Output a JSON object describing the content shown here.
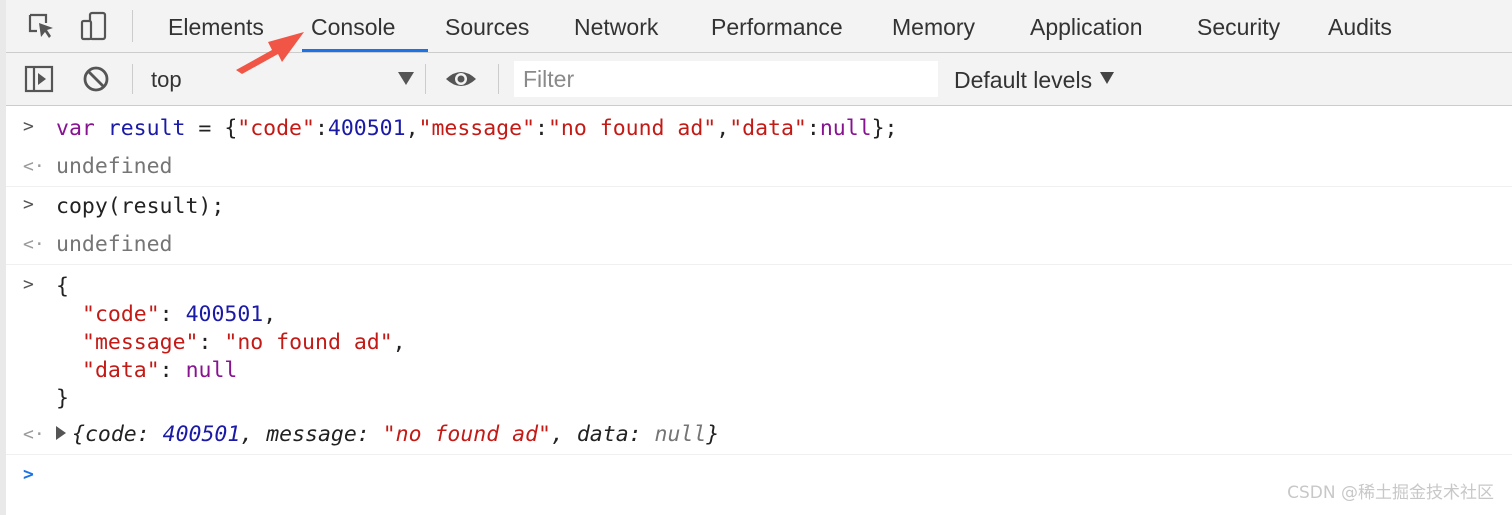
{
  "tabs": [
    "Elements",
    "Console",
    "Sources",
    "Network",
    "Performance",
    "Memory",
    "Application",
    "Security",
    "Audits"
  ],
  "active_tab": "Console",
  "toolbar": {
    "context": "top",
    "filter_placeholder": "Filter",
    "levels": "Default levels"
  },
  "console": {
    "line1": {
      "kw": "var",
      "ident": "result",
      "eq": " = ",
      "open": "{",
      "k1": "\"code\"",
      "v1": "400501",
      "k2": "\"message\"",
      "v2": "\"no found ad\"",
      "k3": "\"data\"",
      "v3": "null",
      "close": "};"
    },
    "result1": "undefined",
    "line2": "copy(result);",
    "result2": "undefined",
    "json": {
      "open": "{",
      "code_key": "\"code\"",
      "code_val": "400501",
      "message_key": "\"message\"",
      "message_val": "\"no found ad\"",
      "data_key": "\"data\"",
      "data_val": "null",
      "close": "}"
    },
    "object": {
      "open": "{",
      "code_key": "code",
      "code_val": "400501",
      "message_key": "message",
      "message_val": "\"no found ad\"",
      "data_key": "data",
      "data_val": "null",
      "close": "}"
    }
  },
  "watermark": "CSDN @稀土掘金技术社区",
  "colors": {
    "accent": "#1a73e8",
    "string": "#c41a16",
    "number": "#1a1aa6",
    "keyword": "#881391",
    "arrow": "#f05545"
  }
}
